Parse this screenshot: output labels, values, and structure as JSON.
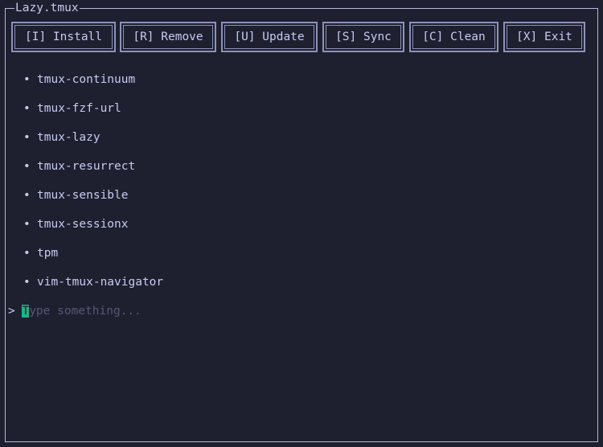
{
  "window": {
    "title": "Lazy.tmux"
  },
  "buttons": [
    {
      "label": "[I] Install"
    },
    {
      "label": "[R] Remove"
    },
    {
      "label": "[U] Update"
    },
    {
      "label": "[S] Sync"
    },
    {
      "label": "[C] Clean"
    },
    {
      "label": "[X] Exit"
    }
  ],
  "plugins": [
    "tmux-continuum",
    "tmux-fzf-url",
    "tmux-lazy",
    "tmux-resurrect",
    "tmux-sensible",
    "tmux-sessionx",
    "tpm",
    "vim-tmux-navigator"
  ],
  "bullet": "•",
  "input": {
    "prompt": ">",
    "value": "",
    "placeholder_first": "T",
    "placeholder_rest": "ype something..."
  }
}
